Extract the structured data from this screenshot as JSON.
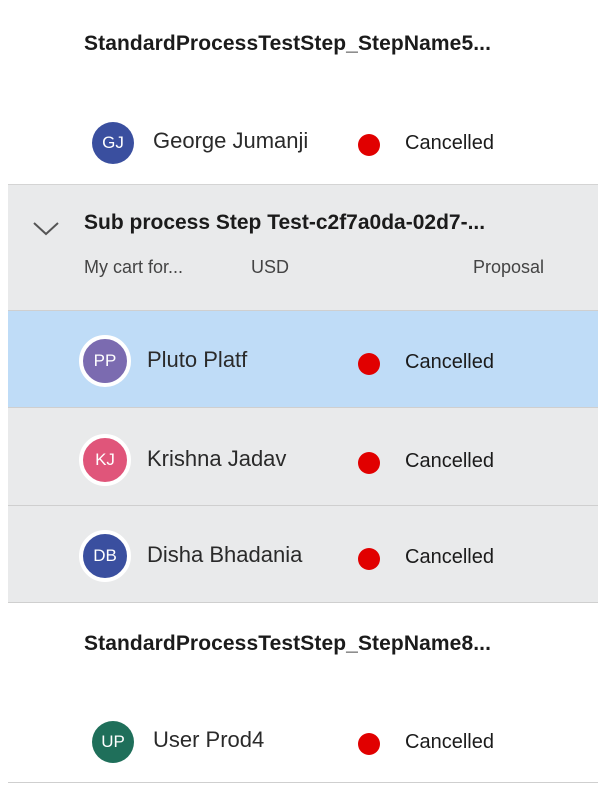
{
  "groups": [
    {
      "title": "StandardProcessTestStep_StepName5..."
    },
    {
      "title": "StandardProcessTestStep_StepName8..."
    }
  ],
  "sub_process": {
    "title": "Sub process Step Test-c2f7a0da-02d7-...",
    "cart": "My cart for...",
    "currency": "USD",
    "stage": "Proposal",
    "icon": "chevron-down-icon"
  },
  "rows": [
    {
      "initials": "GJ",
      "name": "George Jumanji",
      "status": "Cancelled",
      "avatar_color": "#3a4f9f"
    },
    {
      "initials": "PP",
      "name": "Pluto Platf",
      "status": "Cancelled",
      "avatar_color": "#7b6bb0"
    },
    {
      "initials": "KJ",
      "name": "Krishna Jadav",
      "status": "Cancelled",
      "avatar_color": "#e0557a"
    },
    {
      "initials": "DB",
      "name": "Disha Bhadania",
      "status": "Cancelled",
      "avatar_color": "#3a4f9f"
    },
    {
      "initials": "UP",
      "name": "User Prod4",
      "status": "Cancelled",
      "avatar_color": "#1f6f5a"
    }
  ],
  "colors": {
    "status_dot": "#e10000",
    "selected_row": "#bfdcf7",
    "sub_bg": "#e9eaeb"
  }
}
